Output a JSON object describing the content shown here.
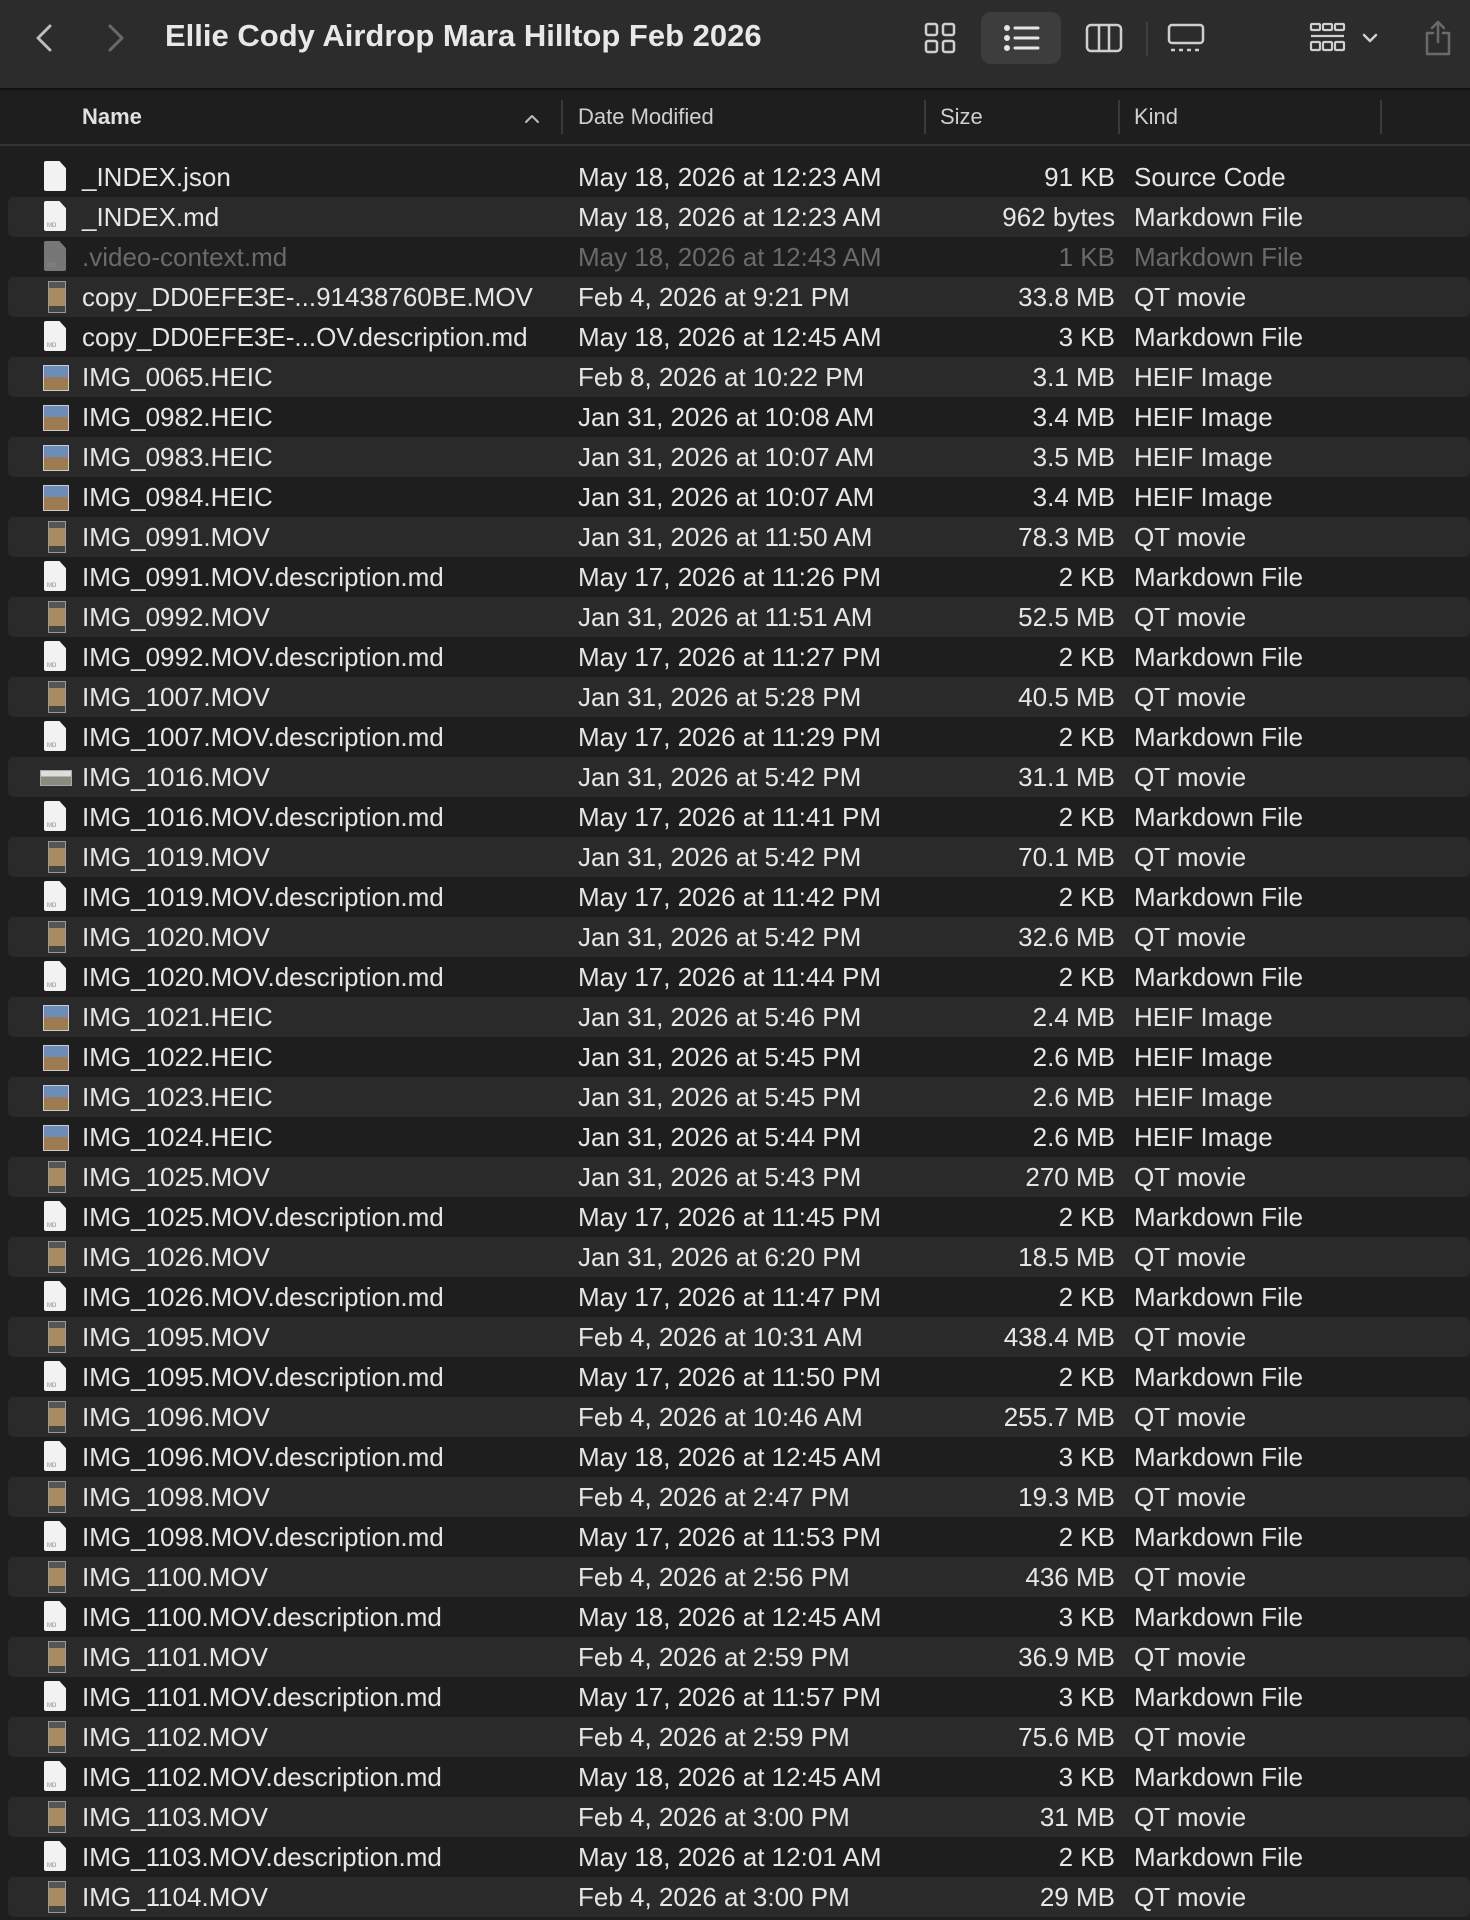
{
  "window": {
    "title": "Ellie Cody Airdrop Mara Hilltop Feb 2026",
    "toolbar_icons": [
      "back-icon",
      "forward-icon",
      "icon-view-icon",
      "list-view-icon",
      "column-view-icon",
      "gallery-view-icon",
      "group-icon",
      "chevron-down-icon",
      "share-icon"
    ]
  },
  "columns": {
    "name": "Name",
    "date": "Date Modified",
    "size": "Size",
    "kind": "Kind"
  },
  "files": [
    {
      "name": "_INDEX.json",
      "date": "May 18, 2026 at 12:23 AM",
      "size": "91 KB",
      "kind": "Source Code",
      "icon": "doc-icon"
    },
    {
      "name": "_INDEX.md",
      "date": "May 18, 2026 at 12:23 AM",
      "size": "962 bytes",
      "kind": "Markdown File",
      "icon": "markdown-icon"
    },
    {
      "name": ".video-context.md",
      "date": "May 18, 2026 at 12:43 AM",
      "size": "1 KB",
      "kind": "Markdown File",
      "icon": "markdown-icon",
      "hidden": true
    },
    {
      "name": "copy_DD0EFE3E-...91438760BE.MOV",
      "date": "Feb 4, 2026 at 9:21 PM",
      "size": "33.8 MB",
      "kind": "QT movie",
      "icon": "video-thumbnail-icon"
    },
    {
      "name": "copy_DD0EFE3E-...OV.description.md",
      "date": "May 18, 2026 at 12:45 AM",
      "size": "3 KB",
      "kind": "Markdown File",
      "icon": "markdown-icon"
    },
    {
      "name": "IMG_0065.HEIC",
      "date": "Feb 8, 2026 at 10:22 PM",
      "size": "3.1 MB",
      "kind": "HEIF Image",
      "icon": "image-thumbnail-icon"
    },
    {
      "name": "IMG_0982.HEIC",
      "date": "Jan 31, 2026 at 10:08 AM",
      "size": "3.4 MB",
      "kind": "HEIF Image",
      "icon": "image-thumbnail-icon"
    },
    {
      "name": "IMG_0983.HEIC",
      "date": "Jan 31, 2026 at 10:07 AM",
      "size": "3.5 MB",
      "kind": "HEIF Image",
      "icon": "image-thumbnail-icon"
    },
    {
      "name": "IMG_0984.HEIC",
      "date": "Jan 31, 2026 at 10:07 AM",
      "size": "3.4 MB",
      "kind": "HEIF Image",
      "icon": "image-thumbnail-icon"
    },
    {
      "name": "IMG_0991.MOV",
      "date": "Jan 31, 2026 at 11:50 AM",
      "size": "78.3 MB",
      "kind": "QT movie",
      "icon": "video-thumbnail-icon"
    },
    {
      "name": "IMG_0991.MOV.description.md",
      "date": "May 17, 2026 at 11:26 PM",
      "size": "2 KB",
      "kind": "Markdown File",
      "icon": "markdown-icon"
    },
    {
      "name": "IMG_0992.MOV",
      "date": "Jan 31, 2026 at 11:51 AM",
      "size": "52.5 MB",
      "kind": "QT movie",
      "icon": "video-thumbnail-icon"
    },
    {
      "name": "IMG_0992.MOV.description.md",
      "date": "May 17, 2026 at 11:27 PM",
      "size": "2 KB",
      "kind": "Markdown File",
      "icon": "markdown-icon"
    },
    {
      "name": "IMG_1007.MOV",
      "date": "Jan 31, 2026 at 5:28 PM",
      "size": "40.5 MB",
      "kind": "QT movie",
      "icon": "video-thumbnail-icon"
    },
    {
      "name": "IMG_1007.MOV.description.md",
      "date": "May 17, 2026 at 11:29 PM",
      "size": "2 KB",
      "kind": "Markdown File",
      "icon": "markdown-icon"
    },
    {
      "name": "IMG_1016.MOV",
      "date": "Jan 31, 2026 at 5:42 PM",
      "size": "31.1 MB",
      "kind": "QT movie",
      "icon": "wide-video-thumbnail-icon"
    },
    {
      "name": "IMG_1016.MOV.description.md",
      "date": "May 17, 2026 at 11:41 PM",
      "size": "2 KB",
      "kind": "Markdown File",
      "icon": "markdown-icon"
    },
    {
      "name": "IMG_1019.MOV",
      "date": "Jan 31, 2026 at 5:42 PM",
      "size": "70.1 MB",
      "kind": "QT movie",
      "icon": "video-thumbnail-icon"
    },
    {
      "name": "IMG_1019.MOV.description.md",
      "date": "May 17, 2026 at 11:42 PM",
      "size": "2 KB",
      "kind": "Markdown File",
      "icon": "markdown-icon"
    },
    {
      "name": "IMG_1020.MOV",
      "date": "Jan 31, 2026 at 5:42 PM",
      "size": "32.6 MB",
      "kind": "QT movie",
      "icon": "video-thumbnail-icon"
    },
    {
      "name": "IMG_1020.MOV.description.md",
      "date": "May 17, 2026 at 11:44 PM",
      "size": "2 KB",
      "kind": "Markdown File",
      "icon": "markdown-icon"
    },
    {
      "name": "IMG_1021.HEIC",
      "date": "Jan 31, 2026 at 5:46 PM",
      "size": "2.4 MB",
      "kind": "HEIF Image",
      "icon": "image-thumbnail-icon"
    },
    {
      "name": "IMG_1022.HEIC",
      "date": "Jan 31, 2026 at 5:45 PM",
      "size": "2.6 MB",
      "kind": "HEIF Image",
      "icon": "image-thumbnail-icon"
    },
    {
      "name": "IMG_1023.HEIC",
      "date": "Jan 31, 2026 at 5:45 PM",
      "size": "2.6 MB",
      "kind": "HEIF Image",
      "icon": "image-thumbnail-icon"
    },
    {
      "name": "IMG_1024.HEIC",
      "date": "Jan 31, 2026 at 5:44 PM",
      "size": "2.6 MB",
      "kind": "HEIF Image",
      "icon": "image-thumbnail-icon"
    },
    {
      "name": "IMG_1025.MOV",
      "date": "Jan 31, 2026 at 5:43 PM",
      "size": "270 MB",
      "kind": "QT movie",
      "icon": "video-thumbnail-icon"
    },
    {
      "name": "IMG_1025.MOV.description.md",
      "date": "May 17, 2026 at 11:45 PM",
      "size": "2 KB",
      "kind": "Markdown File",
      "icon": "markdown-icon"
    },
    {
      "name": "IMG_1026.MOV",
      "date": "Jan 31, 2026 at 6:20 PM",
      "size": "18.5 MB",
      "kind": "QT movie",
      "icon": "video-thumbnail-icon"
    },
    {
      "name": "IMG_1026.MOV.description.md",
      "date": "May 17, 2026 at 11:47 PM",
      "size": "2 KB",
      "kind": "Markdown File",
      "icon": "markdown-icon"
    },
    {
      "name": "IMG_1095.MOV",
      "date": "Feb 4, 2026 at 10:31 AM",
      "size": "438.4 MB",
      "kind": "QT movie",
      "icon": "video-thumbnail-icon"
    },
    {
      "name": "IMG_1095.MOV.description.md",
      "date": "May 17, 2026 at 11:50 PM",
      "size": "2 KB",
      "kind": "Markdown File",
      "icon": "markdown-icon"
    },
    {
      "name": "IMG_1096.MOV",
      "date": "Feb 4, 2026 at 10:46 AM",
      "size": "255.7 MB",
      "kind": "QT movie",
      "icon": "video-thumbnail-icon"
    },
    {
      "name": "IMG_1096.MOV.description.md",
      "date": "May 18, 2026 at 12:45 AM",
      "size": "3 KB",
      "kind": "Markdown File",
      "icon": "markdown-icon"
    },
    {
      "name": "IMG_1098.MOV",
      "date": "Feb 4, 2026 at 2:47 PM",
      "size": "19.3 MB",
      "kind": "QT movie",
      "icon": "video-thumbnail-icon"
    },
    {
      "name": "IMG_1098.MOV.description.md",
      "date": "May 17, 2026 at 11:53 PM",
      "size": "2 KB",
      "kind": "Markdown File",
      "icon": "markdown-icon"
    },
    {
      "name": "IMG_1100.MOV",
      "date": "Feb 4, 2026 at 2:56 PM",
      "size": "436 MB",
      "kind": "QT movie",
      "icon": "video-thumbnail-icon"
    },
    {
      "name": "IMG_1100.MOV.description.md",
      "date": "May 18, 2026 at 12:45 AM",
      "size": "3 KB",
      "kind": "Markdown File",
      "icon": "markdown-icon"
    },
    {
      "name": "IMG_1101.MOV",
      "date": "Feb 4, 2026 at 2:59 PM",
      "size": "36.9 MB",
      "kind": "QT movie",
      "icon": "video-thumbnail-icon"
    },
    {
      "name": "IMG_1101.MOV.description.md",
      "date": "May 17, 2026 at 11:57 PM",
      "size": "3 KB",
      "kind": "Markdown File",
      "icon": "markdown-icon"
    },
    {
      "name": "IMG_1102.MOV",
      "date": "Feb 4, 2026 at 2:59 PM",
      "size": "75.6 MB",
      "kind": "QT movie",
      "icon": "video-thumbnail-icon"
    },
    {
      "name": "IMG_1102.MOV.description.md",
      "date": "May 18, 2026 at 12:45 AM",
      "size": "3 KB",
      "kind": "Markdown File",
      "icon": "markdown-icon"
    },
    {
      "name": "IMG_1103.MOV",
      "date": "Feb 4, 2026 at 3:00 PM",
      "size": "31 MB",
      "kind": "QT movie",
      "icon": "video-thumbnail-icon"
    },
    {
      "name": "IMG_1103.MOV.description.md",
      "date": "May 18, 2026 at 12:01 AM",
      "size": "2 KB",
      "kind": "Markdown File",
      "icon": "markdown-icon"
    },
    {
      "name": "IMG_1104.MOV",
      "date": "Feb 4, 2026 at 3:00 PM",
      "size": "29 MB",
      "kind": "QT movie",
      "icon": "video-thumbnail-icon"
    }
  ]
}
